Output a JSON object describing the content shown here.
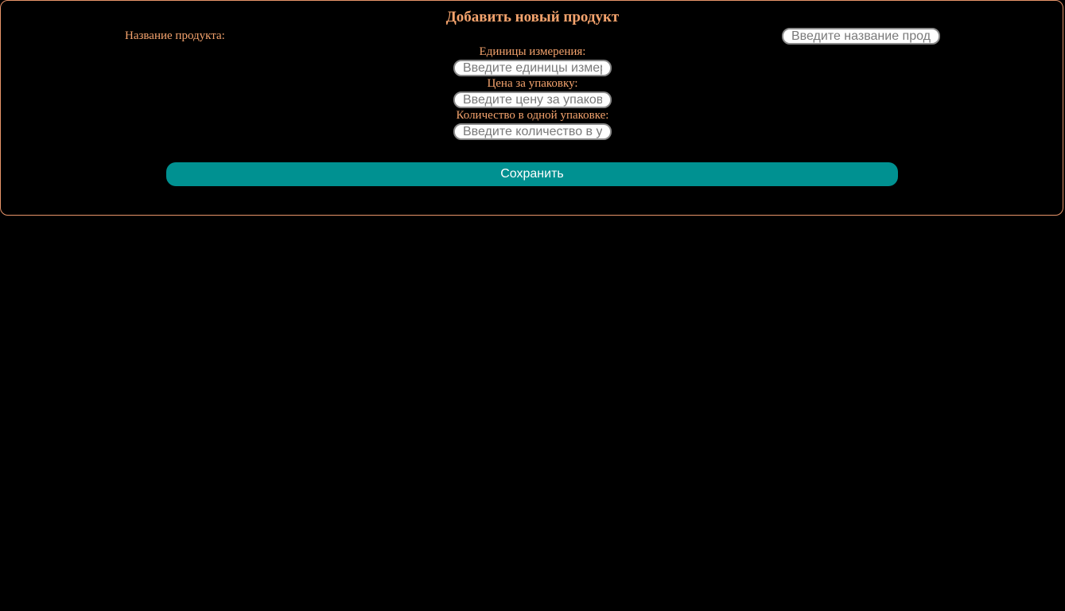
{
  "form": {
    "title": "Добавить новый продукт",
    "fields": [
      {
        "label": "Название продукта:",
        "placeholder": "Введите название продукта"
      },
      {
        "label": "Единицы измерения:",
        "placeholder": "Введите единицы измерения"
      },
      {
        "label": "Цена за упаковку:",
        "placeholder": "Введите цену за упаковку"
      },
      {
        "label": "Количество в одной упаковке:",
        "placeholder": "Введите количество в упаковке"
      }
    ],
    "save_label": "Сохранить"
  },
  "colors": {
    "background": "#000000",
    "accent_text": "#f4a36d",
    "border": "#e8956a",
    "button": "#009191",
    "button_text": "#ffffff"
  }
}
